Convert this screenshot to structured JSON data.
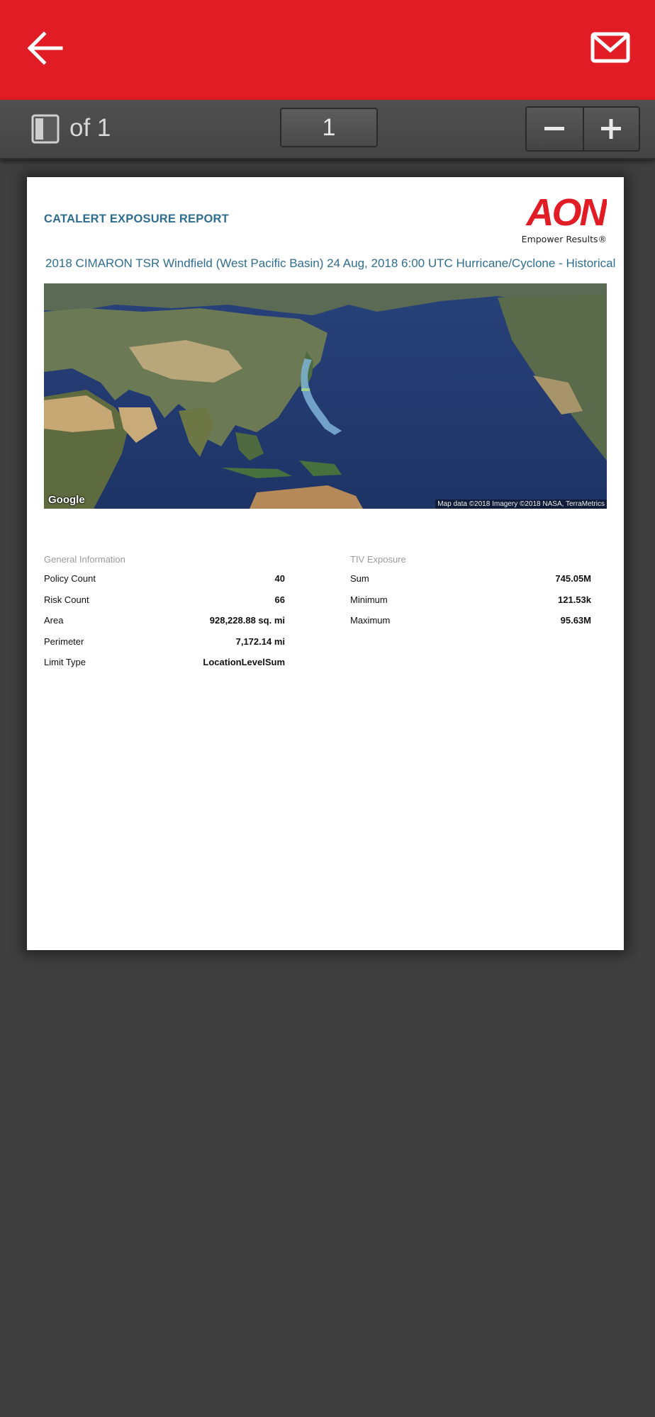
{
  "toolbar": {
    "page_of": "of 1",
    "current_page": "1"
  },
  "report": {
    "title": "CATALERT EXPOSURE REPORT",
    "logo_text": "AON",
    "logo_tagline": "Empower Results®",
    "event_title": "2018 CIMARON TSR Windfield (West Pacific Basin) 24 Aug, 2018 6:00 UTC Hurricane/Cyclone - Historical",
    "map": {
      "google_label": "Google",
      "credit": "Map data ©2018  Imagery ©2018 NASA, TerraMetrics"
    },
    "general_information": {
      "title": "General Information",
      "rows": [
        {
          "label": "Policy Count",
          "value": "40"
        },
        {
          "label": "Risk Count",
          "value": "66"
        },
        {
          "label": "Area",
          "value": "928,228.88 sq. mi"
        },
        {
          "label": "Perimeter",
          "value": "7,172.14 mi"
        },
        {
          "label": "Limit Type",
          "value": "LocationLevelSum"
        }
      ]
    },
    "tiv_exposure": {
      "title": "TIV Exposure",
      "rows": [
        {
          "label": "Sum",
          "value": "745.05M"
        },
        {
          "label": "Minimum",
          "value": "121.53k"
        },
        {
          "label": "Maximum",
          "value": "95.63M"
        }
      ]
    }
  },
  "colors": {
    "brand_red": "#e11c24",
    "report_blue": "#2f6e8f",
    "viewer_bg": "#3f3f3f"
  },
  "icons": {
    "back": "arrow-left-icon",
    "mail": "mail-icon",
    "sidebar": "sidebar-toggle-icon",
    "zoom_out": "minus-icon",
    "zoom_in": "plus-icon"
  }
}
